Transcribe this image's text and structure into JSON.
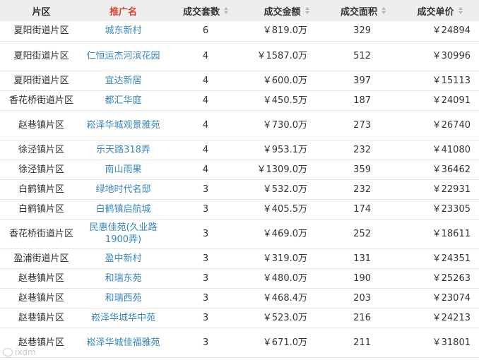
{
  "table": {
    "headers": {
      "area": "片区",
      "project": "推广名",
      "count": "成交套数",
      "amount": "成交金额",
      "size": "成交面积",
      "price": "成交单价"
    },
    "rows": [
      {
        "area": "夏阳街道片区",
        "project": "城东新村",
        "count": "6",
        "amount": "￥819.0万",
        "size": "329",
        "price": "￥24894"
      },
      {
        "area": "夏阳街道片区",
        "project": "仁恒运杰河滨花园",
        "count": "4",
        "amount": "￥1587.0万",
        "size": "512",
        "price": "￥30996"
      },
      {
        "area": "夏阳街道片区",
        "project": "宜达新居",
        "count": "4",
        "amount": "￥600.0万",
        "size": "397",
        "price": "￥15113"
      },
      {
        "area": "香花桥街道片区",
        "project": "都汇华庭",
        "count": "4",
        "amount": "￥450.5万",
        "size": "187",
        "price": "￥24091"
      },
      {
        "area": "赵巷镇片区",
        "project": "崧泽华城观景雅苑",
        "count": "4",
        "amount": "￥730.0万",
        "size": "273",
        "price": "￥26740"
      },
      {
        "area": "徐泾镇片区",
        "project": "乐天路318弄",
        "count": "4",
        "amount": "￥953.1万",
        "size": "232",
        "price": "￥41080"
      },
      {
        "area": "徐泾镇片区",
        "project": "南山雨果",
        "count": "4",
        "amount": "￥1309.0万",
        "size": "359",
        "price": "￥36462"
      },
      {
        "area": "白鹤镇片区",
        "project": "绿地时代名邸",
        "count": "3",
        "amount": "￥532.0万",
        "size": "232",
        "price": "￥22931"
      },
      {
        "area": "白鹤镇片区",
        "project": "白鹤镇启航城",
        "count": "3",
        "amount": "￥405.5万",
        "size": "174",
        "price": "￥23305"
      },
      {
        "area": "香花桥街道片区",
        "project": "民惠佳苑(久业路1900弄)",
        "count": "3",
        "amount": "￥469.0万",
        "size": "252",
        "price": "￥18611"
      },
      {
        "area": "盈浦街道片区",
        "project": "盈中新村",
        "count": "3",
        "amount": "￥319.0万",
        "size": "131",
        "price": "￥24351"
      },
      {
        "area": "赵巷镇片区",
        "project": "和瑞东苑",
        "count": "3",
        "amount": "￥480.0万",
        "size": "190",
        "price": "￥25263"
      },
      {
        "area": "赵巷镇片区",
        "project": "和瑞西苑",
        "count": "3",
        "amount": "￥468.4万",
        "size": "203",
        "price": "￥23074"
      },
      {
        "area": "赵巷镇片区",
        "project": "崧泽华城华中苑",
        "count": "3",
        "amount": "￥523.0万",
        "size": "216",
        "price": "￥24213"
      },
      {
        "area": "赵巷镇片区",
        "project": "崧泽华城佳福雅苑",
        "count": "3",
        "amount": "￥671.0万",
        "size": "211",
        "price": "￥31801"
      }
    ]
  },
  "watermark": {
    "text": "ixdm"
  },
  "colors": {
    "header_bg": "#eeeeee",
    "active_header": "#d8452f",
    "link": "#3a86b8",
    "row_border": "#e3e3e3"
  }
}
